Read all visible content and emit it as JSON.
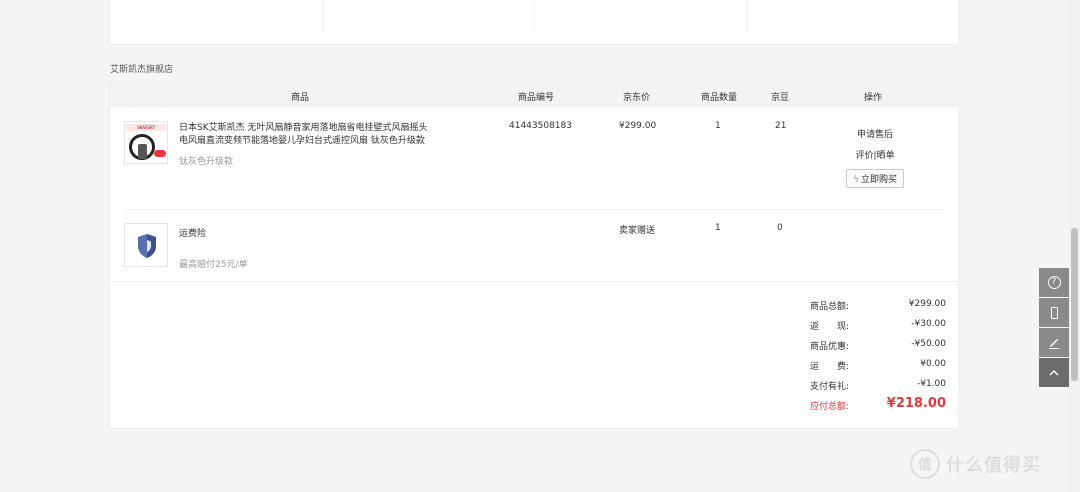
{
  "shop": {
    "name": "艾斯凯杰旗舰店"
  },
  "table": {
    "headers": [
      "商品",
      "商品编号",
      "京东价",
      "商品数量",
      "京豆",
      "操作"
    ]
  },
  "product": {
    "image_brand_text": "SKAESKY",
    "name": "日本SK艾斯凯杰 无叶风扇静音家用落地扇省电挂壁式风扇摇头电风扇直流变频节能落地婴儿孕妇台式遥控风扇 钛灰色升级款",
    "spec": "钛灰色升级款",
    "sku": "41443508183",
    "price": "¥299.00",
    "qty": "1",
    "beans": "21",
    "ops": {
      "after_sale": "申请售后",
      "review": "评价",
      "separator": "|",
      "share": "晒单",
      "buy_again": "立即购买"
    }
  },
  "insurance": {
    "name": "运费险",
    "desc": "最高赔付25元/单",
    "price": "卖家赠送",
    "qty": "1",
    "beans": "0"
  },
  "summary": [
    {
      "label": "商品总额:",
      "value": "¥299.00"
    },
    {
      "label": "返　　现:",
      "value": "-¥30.00"
    },
    {
      "label": "商品优惠:",
      "value": "-¥50.00"
    },
    {
      "label": "运　　费:",
      "value": "¥0.00"
    },
    {
      "label": "支付有礼:",
      "value": "-¥1.00"
    }
  ],
  "total": {
    "label": "应付总额:",
    "value": "¥218.00"
  },
  "sidebar": {
    "help": "?",
    "help_icon": "question-icon",
    "phone_icon": "phone-icon",
    "edit_icon": "edit-icon",
    "top_icon": "arrow-up-icon"
  },
  "watermark": {
    "logo": "值",
    "text": "什么值得买"
  },
  "colors": {
    "accent": "#e4393c",
    "sidebar": "#8a8a8a"
  }
}
